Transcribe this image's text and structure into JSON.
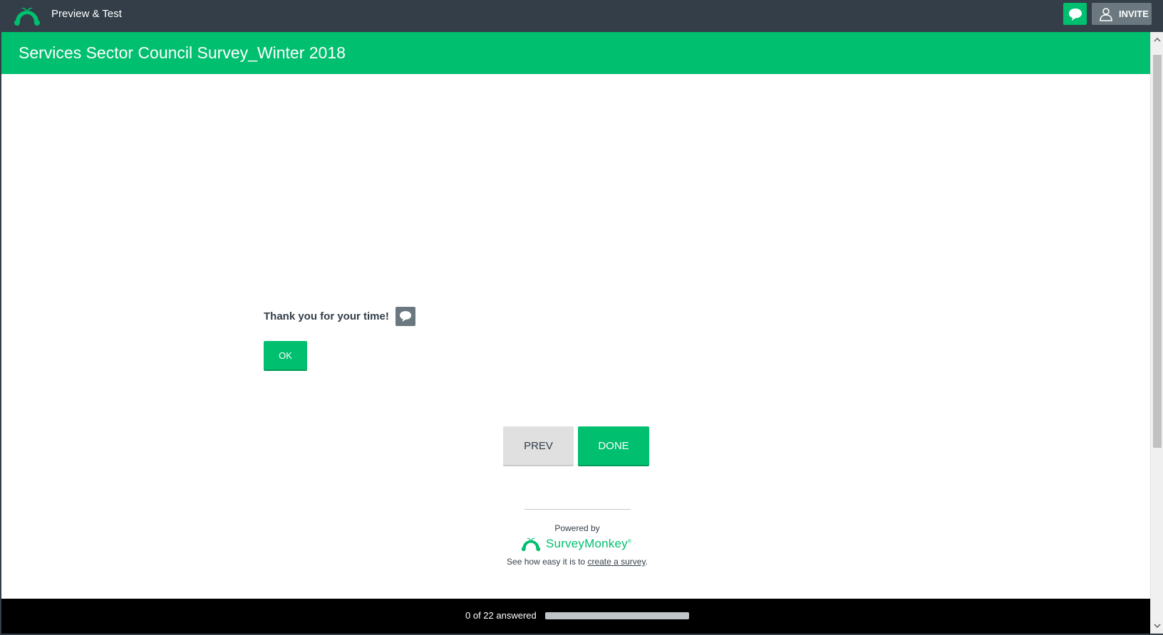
{
  "app": {
    "title": "Preview & Test",
    "invite_label": "INVITE"
  },
  "survey": {
    "title": "Services Sector Council Survey_Winter 2018"
  },
  "question": {
    "text": "Thank you for your time!",
    "ok_label": "OK"
  },
  "nav": {
    "prev_label": "PREV",
    "done_label": "DONE"
  },
  "footer": {
    "powered_by": "Powered by",
    "brand": "SurveyMonkey",
    "see_how_prefix": "See how easy it is to ",
    "create_link": "create a survey",
    "see_how_suffix": "."
  },
  "progress": {
    "text": "0 of 22 answered",
    "answered": 0,
    "total": 22
  },
  "colors": {
    "accent": "#00bf6f",
    "topbar": "#333e48",
    "footer": "#000000"
  },
  "icons": [
    "surveymonkey-logo-icon",
    "chat-bubble-icon",
    "user-icon",
    "comment-icon",
    "chevron-up-icon",
    "chevron-down-icon"
  ]
}
